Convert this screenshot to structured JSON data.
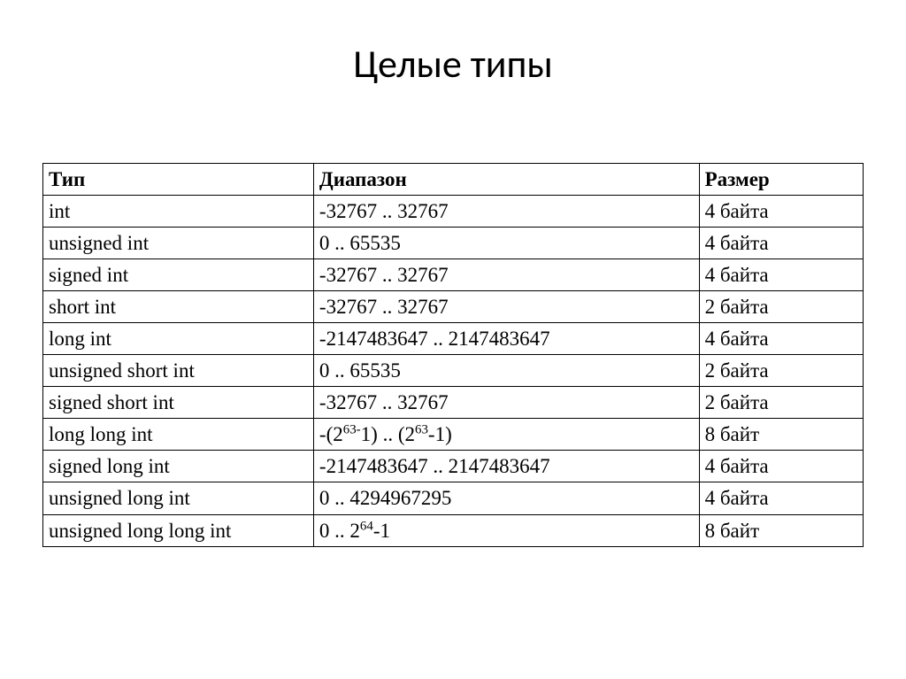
{
  "title": "Целые типы",
  "headers": {
    "type": "Тип",
    "range": "Диапазон",
    "size": "Размер"
  },
  "rows": [
    {
      "type": "int",
      "range": "-32767 .. 32767",
      "size": "4 байта"
    },
    {
      "type": "unsigned int",
      "range": "0 .. 65535",
      "size": "4 байта"
    },
    {
      "type": "signed int",
      "range": "-32767 .. 32767",
      "size": "4 байта"
    },
    {
      "type": "short int",
      "range": "-32767 .. 32767",
      "size": "2 байта"
    },
    {
      "type": "long int",
      "range": "-2147483647 .. 2147483647",
      "size": "4 байта"
    },
    {
      "type": "unsigned short int",
      "range": "0 .. 65535",
      "size": "2 байта"
    },
    {
      "type": "signed short int",
      "range": "-32767 .. 32767",
      "size": "2 байта"
    },
    {
      "type": "long long int",
      "range_html": "-(2<sup>63-</sup>1) .. (2<sup>63</sup>-1)",
      "size": "8 байт"
    },
    {
      "type": "signed long int",
      "range": "-2147483647 .. 2147483647",
      "size": "4 байта"
    },
    {
      "type": "unsigned long int",
      "range": "0 .. 4294967295",
      "size": "4 байта"
    },
    {
      "type": "unsigned long long int",
      "range_html": "0 .. 2<sup>64</sup>-1",
      "size": "8 байт"
    }
  ],
  "chart_data": {
    "type": "table",
    "title": "Целые типы",
    "columns": [
      "Тип",
      "Диапазон",
      "Размер"
    ],
    "rows": [
      [
        "int",
        "-32767 .. 32767",
        "4 байта"
      ],
      [
        "unsigned int",
        "0 .. 65535",
        "4 байта"
      ],
      [
        "signed int",
        "-32767 .. 32767",
        "4 байта"
      ],
      [
        "short int",
        "-32767 .. 32767",
        "2 байта"
      ],
      [
        "long int",
        "-2147483647 .. 2147483647",
        "4 байта"
      ],
      [
        "unsigned short int",
        "0 .. 65535",
        "2 байта"
      ],
      [
        "signed short int",
        "-32767 .. 32767",
        "2 байта"
      ],
      [
        "long long int",
        "-(2^63-1) .. (2^63-1)",
        "8 байт"
      ],
      [
        "signed long int",
        "-2147483647 .. 2147483647",
        "4 байта"
      ],
      [
        "unsigned long int",
        "0 .. 4294967295",
        "4 байта"
      ],
      [
        "unsigned long long int",
        "0 .. 2^64-1",
        "8 байт"
      ]
    ]
  }
}
